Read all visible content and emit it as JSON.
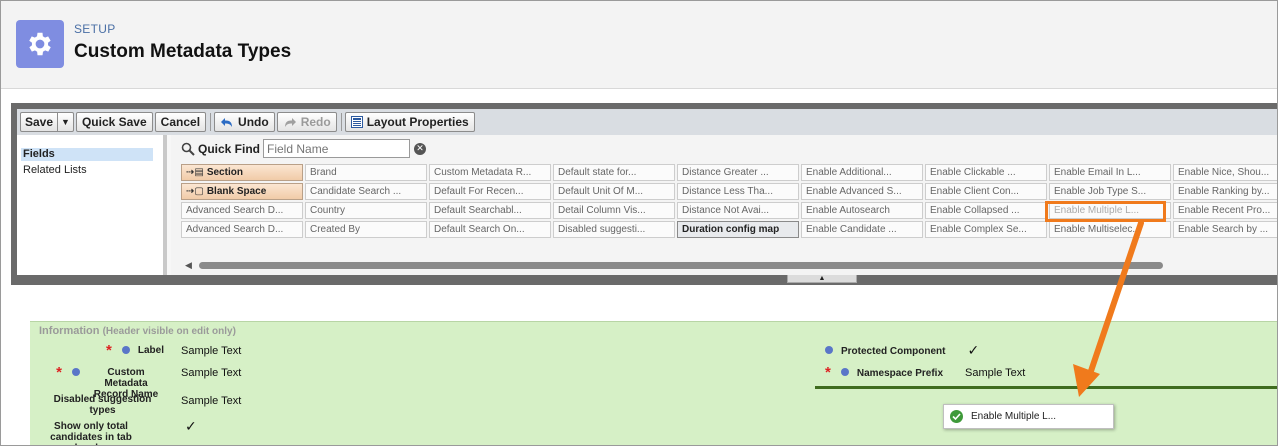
{
  "header": {
    "breadcrumb": "SETUP",
    "title": "Custom Metadata Types"
  },
  "toolbar": {
    "save": "Save",
    "quick_save": "Quick Save",
    "cancel": "Cancel",
    "undo": "Undo",
    "redo": "Redo",
    "layout_properties": "Layout Properties"
  },
  "categories": [
    "Fields",
    "Related Lists"
  ],
  "quick_find": {
    "label": "Quick Find",
    "placeholder": "Field Name"
  },
  "palette_rows": [
    [
      "Section",
      "Brand",
      "Custom Metadata R...",
      "Default state for...",
      "Distance Greater ...",
      "Enable Additional...",
      "Enable Clickable ...",
      "Enable Email In L...",
      "Enable Nice, Shou..."
    ],
    [
      "Blank Space",
      "Candidate Search ...",
      "Default For Recen...",
      "Default Unit Of M...",
      "Distance Less Tha...",
      "Enable Advanced S...",
      "Enable Client Con...",
      "Enable Job Type S...",
      "Enable Ranking by..."
    ],
    [
      "Advanced Search D...",
      "Country",
      "Default Searchabl...",
      "Detail Column Vis...",
      "Distance Not Avai...",
      "Enable Autosearch",
      "Enable Collapsed ...",
      "Enable Multiple L...",
      "Enable Recent Pro..."
    ],
    [
      "Advanced Search D...",
      "Created By",
      "Default Search On...",
      "Disabled suggesti...",
      "Duration config map",
      "Enable Candidate ...",
      "Enable Complex Se...",
      "Enable Multiselec...",
      "Enable Search by ..."
    ]
  ],
  "section": {
    "title": "Information",
    "note": "(Header visible on edit only)"
  },
  "left_fields": [
    {
      "label": "Label",
      "value": "Sample Text"
    },
    {
      "label": "Custom Metadata Record Name",
      "value": "Sample Text"
    },
    {
      "label": "Disabled suggestion types",
      "value": "Sample Text"
    },
    {
      "label": "Show only total candidates in tab header",
      "value": "✓"
    }
  ],
  "right_fields": [
    {
      "label": "Protected Component",
      "value": "✓"
    },
    {
      "label": "Namespace Prefix",
      "value": "Sample Text"
    }
  ],
  "drag_item": "Enable Multiple L...",
  "colors": {
    "accent": "#7f8de1",
    "section_bg": "#d6f0c6",
    "annotation": "#f07a1c",
    "required": "#dd2222"
  }
}
